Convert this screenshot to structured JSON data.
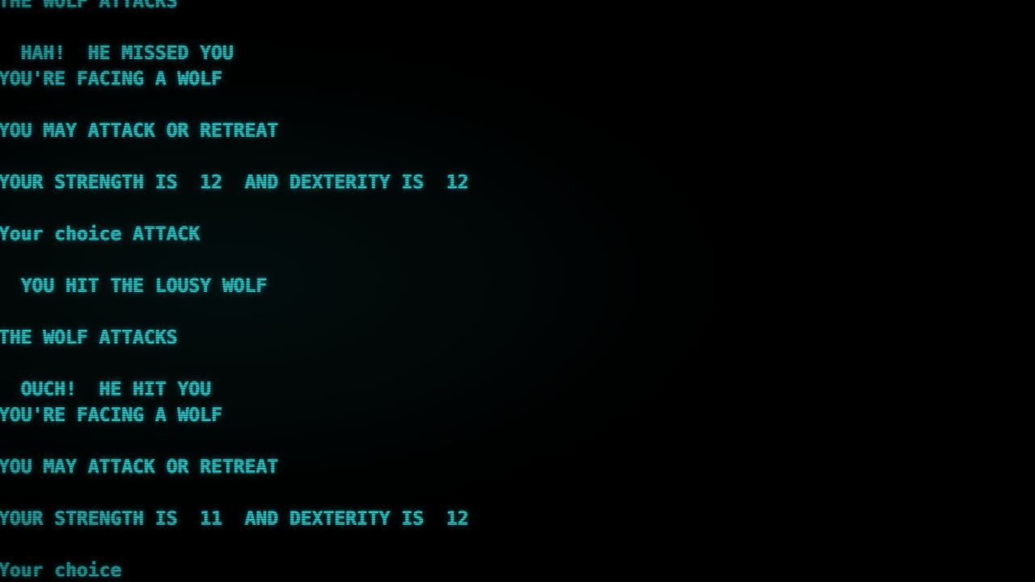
{
  "screen": {
    "kind": "crt-terminal",
    "background_color": "#000000",
    "text_color": "#2ec8c8",
    "program": "text-adventure-combat-loop"
  },
  "console": {
    "lines": [
      {
        "id": "wolf-attacks-1",
        "text": "THE WOLF ATTACKS",
        "clipped": "top"
      },
      {
        "id": "blank-1",
        "text": ""
      },
      {
        "id": "hah-missed",
        "text": "  HAH!  HE MISSED YOU"
      },
      {
        "id": "facing-wolf-1",
        "text": "YOU'RE FACING A WOLF"
      },
      {
        "id": "blank-2",
        "text": ""
      },
      {
        "id": "attack-or-retreat-1",
        "text": "YOU MAY ATTACK OR RETREAT"
      },
      {
        "id": "blank-3",
        "text": ""
      },
      {
        "id": "stats-1",
        "text": "YOUR STRENGTH IS  12  AND DEXTERITY IS  12"
      },
      {
        "id": "blank-4",
        "text": ""
      },
      {
        "id": "prompt-1",
        "text": "Your choice ATTACK"
      },
      {
        "id": "blank-5",
        "text": ""
      },
      {
        "id": "you-hit-wolf",
        "text": "  YOU HIT THE LOUSY WOLF"
      },
      {
        "id": "blank-6",
        "text": ""
      },
      {
        "id": "wolf-attacks-2",
        "text": "THE WOLF ATTACKS"
      },
      {
        "id": "blank-7",
        "text": ""
      },
      {
        "id": "ouch-hit",
        "text": "  OUCH!  HE HIT YOU"
      },
      {
        "id": "facing-wolf-2",
        "text": "YOU'RE FACING A WOLF"
      },
      {
        "id": "blank-8",
        "text": ""
      },
      {
        "id": "attack-or-retreat-2",
        "text": "YOU MAY ATTACK OR RETREAT"
      },
      {
        "id": "blank-9",
        "text": ""
      },
      {
        "id": "stats-2",
        "text": "YOUR STRENGTH IS  11  AND DEXTERITY IS  12"
      },
      {
        "id": "blank-10",
        "text": ""
      },
      {
        "id": "prompt-2",
        "text": "Your choice",
        "clipped": "bottom"
      }
    ]
  },
  "game_state": {
    "enemy": "WOLF",
    "prompt_label": "Your choice",
    "last_input": "ATTACK",
    "available_commands": [
      "ATTACK",
      "RETREAT"
    ],
    "turns": [
      {
        "strength": 12,
        "dexterity": 12,
        "enemy_result": "HE MISSED YOU",
        "player_result": "YOU HIT THE LOUSY WOLF"
      },
      {
        "strength": 11,
        "dexterity": 12,
        "enemy_result": "HE HIT YOU",
        "player_result": null
      }
    ]
  }
}
